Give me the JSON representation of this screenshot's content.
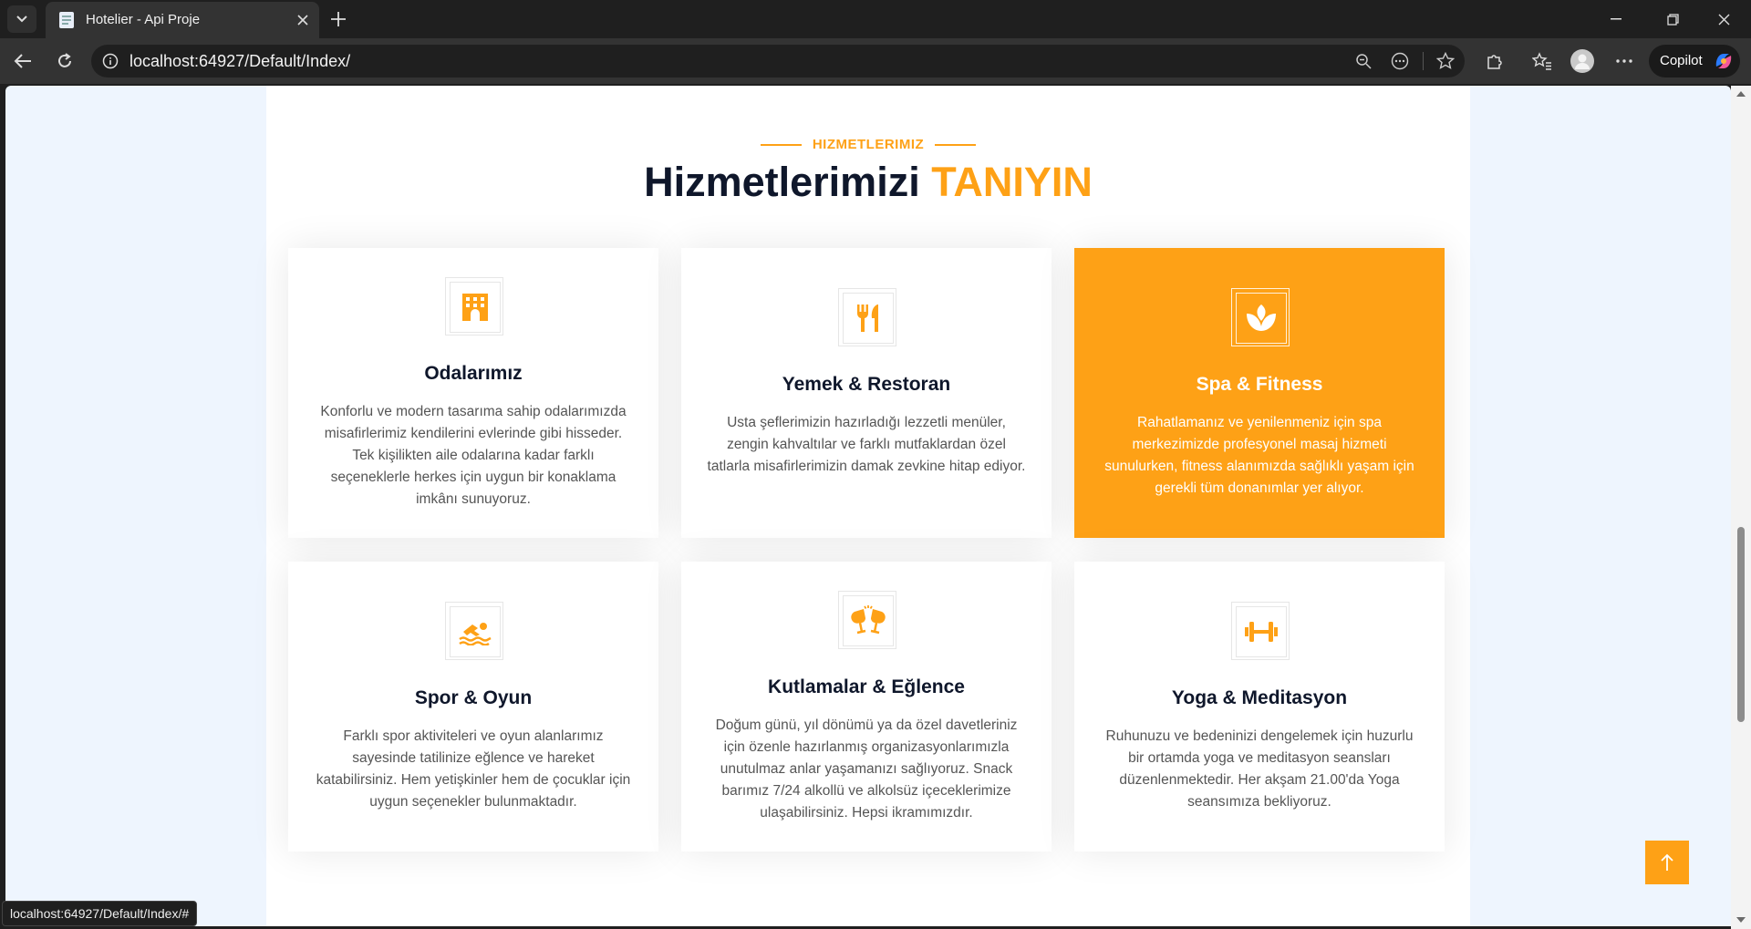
{
  "browser": {
    "tab_title": "Hotelier - Api Proje",
    "url": "localhost:64927/Default/Index/",
    "copilot_label": "Copilot",
    "status_url": "localhost:64927/Default/Index/#"
  },
  "section": {
    "eyebrow": "HIZMETLERIMIZ",
    "title_main": "Hizmetlerimizi",
    "title_accent": "TANIYIN"
  },
  "services": [
    {
      "icon": "hotel-icon",
      "title": "Odalarımız",
      "desc": "Konforlu ve modern tasarıma sahip odalarımızda misafirlerimiz kendilerini evlerinde gibi hisseder. Tek kişilikten aile odalarına kadar farklı seçeneklerle herkes için uygun bir konaklama imkânı sunuyoruz."
    },
    {
      "icon": "utensils-icon",
      "title": "Yemek & Restoran",
      "desc": "Usta şeflerimizin hazırladığı lezzetli menüler, zengin kahvaltılar ve farklı mutfaklardan özel tatlarla misafirlerimizin damak zevkine hitap ediyor."
    },
    {
      "icon": "spa-icon",
      "title": "Spa & Fitness",
      "desc": "Rahatlamanız ve yenilenmeniz için spa merkezimizde profesyonel masaj hizmeti sunulurken, fitness alanımızda sağlıklı yaşam için gerekli tüm donanımlar yer alıyor."
    },
    {
      "icon": "swimmer-icon",
      "title": "Spor & Oyun",
      "desc": "Farklı spor aktiviteleri ve oyun alanlarımız sayesinde tatilinize eğlence ve hareket katabilirsiniz. Hem yetişkinler hem de çocuklar için uygun seçenekler bulunmaktadır."
    },
    {
      "icon": "glass-cheers-icon",
      "title": "Kutlamalar & Eğlence",
      "desc": "Doğum günü, yıl dönümü ya da özel davetleriniz için özenle hazırlanmış organizasyonlarımızla unutulmaz anlar yaşamanızı sağlıyoruz. Snack barımız 7/24 alkollü ve alkolsüz içeceklerimize ulaşabilirsiniz. Hepsi ikramımızdır."
    },
    {
      "icon": "dumbbell-icon",
      "title": "Yoga & Meditasyon",
      "desc": "Ruhunuzu ve bedeninizi dengelemek için huzurlu bir ortamda yoga ve meditasyon seansları düzenlenmektedir. Her akşam 21.00'da Yoga seansımıza bekliyoruz."
    }
  ],
  "colors": {
    "accent": "#fea116",
    "dark": "#0f172b"
  }
}
